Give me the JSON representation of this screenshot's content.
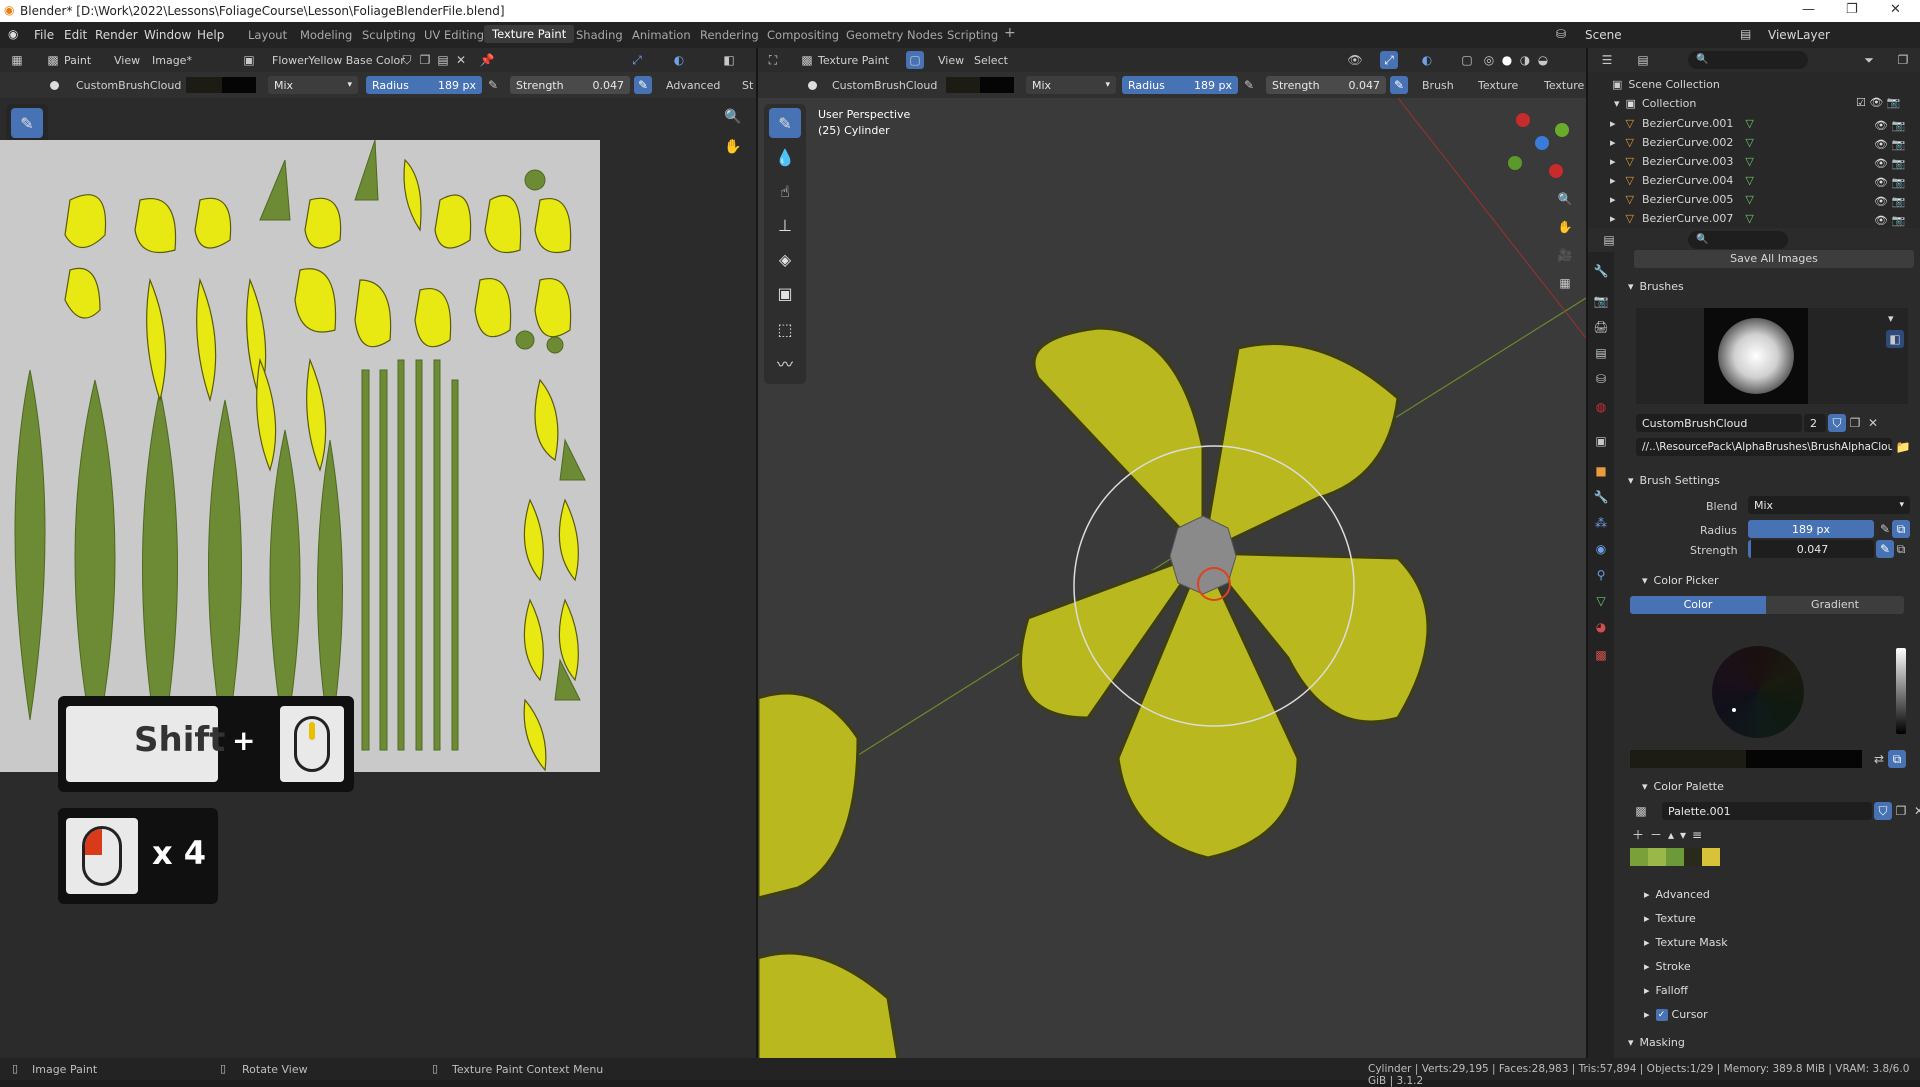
{
  "title": "Blender* [D:\\Work\\2022\\Lessons\\FoliageCourse\\Lesson\\FoliageBlenderFile.blend]",
  "menu": [
    "File",
    "Edit",
    "Render",
    "Window",
    "Help"
  ],
  "workspaces": [
    "Layout",
    "Modeling",
    "Sculpting",
    "UV Editing",
    "Texture Paint",
    "Shading",
    "Animation",
    "Rendering",
    "Compositing",
    "Geometry Nodes",
    "Scripting"
  ],
  "active_workspace": "Texture Paint",
  "scene": "Scene",
  "view_layer": "ViewLayer",
  "image_editor": {
    "mode": "Paint",
    "view": "View",
    "image": "Image*",
    "texture": "FlowerYellow Base Color",
    "brush": "CustomBrushCloud",
    "blend": "Mix",
    "radius_label": "Radius",
    "radius": "189 px",
    "strength_label": "Strength",
    "strength": "0.047",
    "advanced": "Advanced",
    "st": "St"
  },
  "viewport": {
    "mode": "Texture Paint",
    "view": "View",
    "select": "Select",
    "brush": "CustomBrushCloud",
    "blend": "Mix",
    "radius_label": "Radius",
    "radius": "189 px",
    "strength_label": "Strength",
    "strength": "0.047",
    "brush_menu": "Brush",
    "texture_menu": "Texture",
    "texture2": "Texture",
    "perspective": "User Perspective",
    "object": "(25) Cylinder"
  },
  "overlay": {
    "shift": "Shift",
    "plus": "+",
    "times": "x 4"
  },
  "outliner": {
    "scene_collection": "Scene Collection",
    "collection": "Collection",
    "items": [
      "BezierCurve.001",
      "BezierCurve.002",
      "BezierCurve.003",
      "BezierCurve.004",
      "BezierCurve.005",
      "BezierCurve.007"
    ]
  },
  "properties": {
    "save_all": "Save All Images",
    "brushes": "Brushes",
    "brush_name": "CustomBrushCloud",
    "brush_users": "2",
    "brush_path": "//..\\ResourcePack\\AlphaBrushes\\BrushAlphaCloud...",
    "brush_settings": "Brush Settings",
    "blend_label": "Blend",
    "blend": "Mix",
    "radius_label": "Radius",
    "radius": "189 px",
    "strength_label": "Strength",
    "strength": "0.047",
    "color_picker": "Color Picker",
    "color_tab": "Color",
    "gradient_tab": "Gradient",
    "color_palette": "Color Palette",
    "palette": "Palette.001",
    "palette_colors": [
      "#7aa03a",
      "#9ab84a",
      "#6d9a38",
      "#2a2a1c",
      "#d8c23a"
    ],
    "sections": [
      "Advanced",
      "Texture",
      "Texture Mask",
      "Stroke",
      "Falloff",
      "Cursor"
    ],
    "masking": "Masking"
  },
  "status": {
    "left1": "Image Paint",
    "left2": "Rotate View",
    "left3": "Texture Paint Context Menu",
    "stats": "Cylinder | Verts:29,195 | Faces:28,983 | Tris:57,894 | Objects:1/29 | Memory: 389.8 MiB | VRAM: 3.8/6.0 GiB | 3.1.2"
  },
  "colors": {
    "accent": "#4772b3",
    "petal": "#c8c82a",
    "leaf": "#6d8a34"
  }
}
